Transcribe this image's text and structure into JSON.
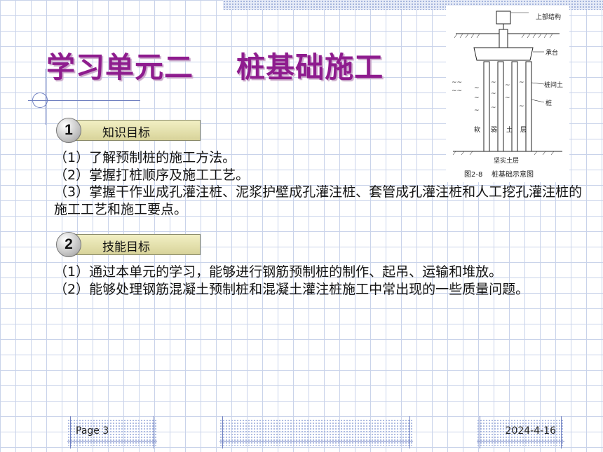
{
  "slide": {
    "title": "学习单元二    桩基础施工"
  },
  "diagram": {
    "labels": {
      "superstructure": "上部结构",
      "cap": "承台",
      "soil_between_piles": "桩间土",
      "pile": "桩",
      "soft_layer": [
        "软",
        "弱",
        "土",
        "层"
      ],
      "firm_layer": "坚实土层",
      "caption": "图2-8    桩基础示意图"
    }
  },
  "sections": [
    {
      "number": "1",
      "heading": "知识目标",
      "items": [
        "（1）了解预制桩的施工方法。",
        "（2）掌握打桩顺序及施工工艺。",
        "（3）掌握干作业成孔灌注桩、泥浆护壁成孔灌注桩、套管成孔灌注桩和人工挖孔灌注桩的施工工艺和施工要点。"
      ]
    },
    {
      "number": "2",
      "heading": "技能目标",
      "items": [
        "（1）通过本单元的学习，能够进行钢筋预制桩的制作、起吊、运输和堆放。",
        "（2）能够处理钢筋混凝土预制桩和混凝土灌注桩施工中常出现的一些质量问题。"
      ]
    }
  ],
  "footer": {
    "page": "Page 3",
    "date": "2024-4-16"
  }
}
